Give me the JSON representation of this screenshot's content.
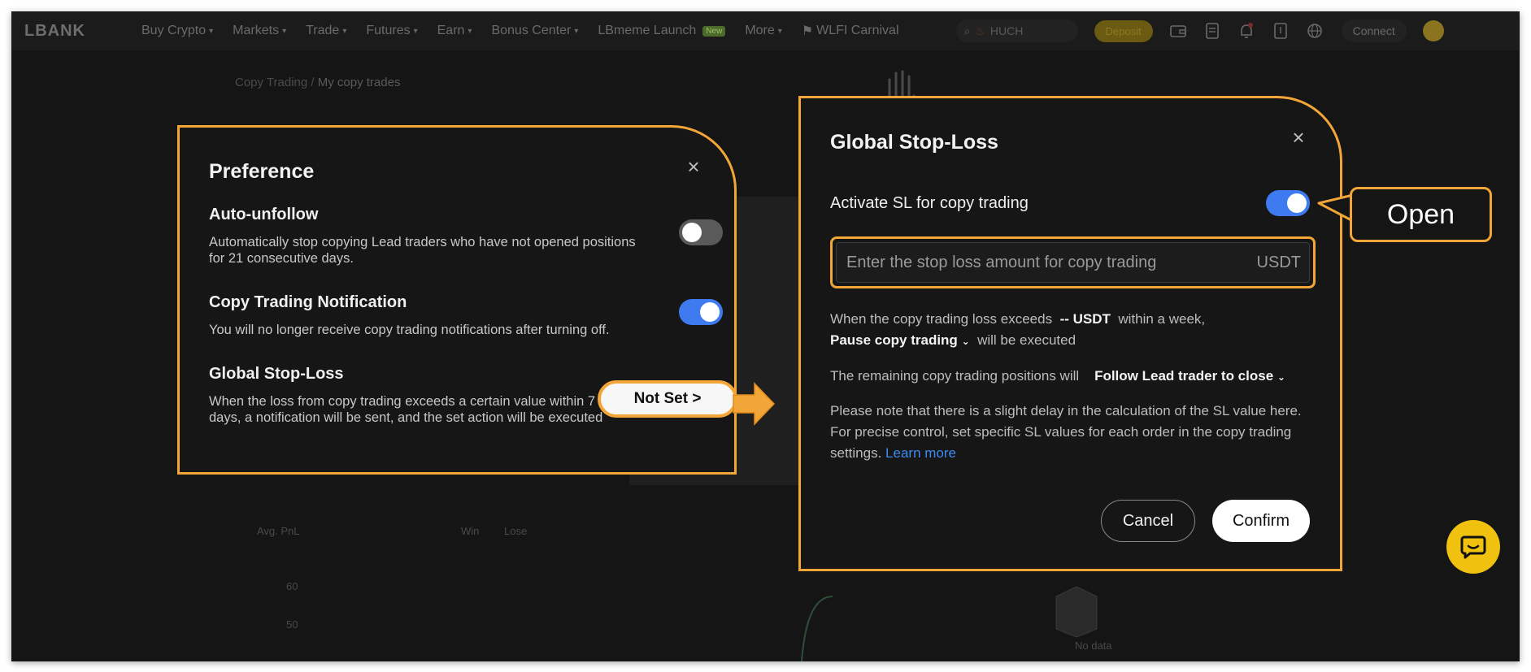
{
  "nav": {
    "logo": "LBANK",
    "items": [
      {
        "label": "Buy Crypto"
      },
      {
        "label": "Markets"
      },
      {
        "label": "Trade"
      },
      {
        "label": "Futures"
      },
      {
        "label": "Earn"
      },
      {
        "label": "Bonus Center"
      },
      {
        "label": "LBmeme Launch",
        "badge": "New"
      },
      {
        "label": "More"
      }
    ],
    "campaign": "WLFI Carnival",
    "search_value": "HUCH",
    "deposit_label": "Deposit",
    "connect_label": "Connect",
    "icons": [
      "wallet-icon",
      "orders-icon",
      "bell-icon",
      "download-icon",
      "globe-icon"
    ]
  },
  "background": {
    "breadcrumb_root": "Copy Trading",
    "breadcrumb_sep": "/",
    "breadcrumb_current": "My copy trades",
    "avg_pnl": "Avg. PnL",
    "win": "Win",
    "lose": "Lose",
    "tick_60": "60",
    "tick_50": "50",
    "no_data": "No data"
  },
  "preference": {
    "title": "Preference",
    "auto_unfollow": {
      "title": "Auto-unfollow",
      "desc": "Automatically stop copying Lead traders who have not opened positions for 21 consecutive days.",
      "enabled": false
    },
    "notification": {
      "title": "Copy Trading Notification",
      "desc": "You will no longer receive copy trading notifications after turning off.",
      "enabled": true
    },
    "stop_loss": {
      "title": "Global Stop-Loss",
      "desc": "When the loss from copy trading exceeds a certain value within 7 days, a notification will be sent, and the set action will be executed"
    }
  },
  "callouts": {
    "not_set": "Not Set >",
    "open": "Open"
  },
  "global_sl": {
    "title": "Global Stop-Loss",
    "activate_label": "Activate SL for copy trading",
    "activate_enabled": true,
    "input_placeholder": "Enter the stop loss amount for copy trading",
    "input_unit": "USDT",
    "line1_prefix": "When the copy trading loss exceeds",
    "line1_value": "-- USDT",
    "line1_suffix": "within a week,",
    "action_select": "Pause copy trading",
    "action_suffix": "will be executed",
    "remaining_prefix": "The remaining copy trading positions will",
    "remaining_select": "Follow Lead trader to close",
    "note": "Please note that there is a slight delay in the calculation of the SL value here. For precise control, set specific SL values for each order in the copy trading settings.",
    "learn_more": "Learn more",
    "cancel_label": "Cancel",
    "confirm_label": "Confirm"
  },
  "colors": {
    "accent": "#f3a638",
    "toggle_on": "#3f7bf0",
    "link": "#3d8bf2",
    "chat": "#f0c20f"
  }
}
